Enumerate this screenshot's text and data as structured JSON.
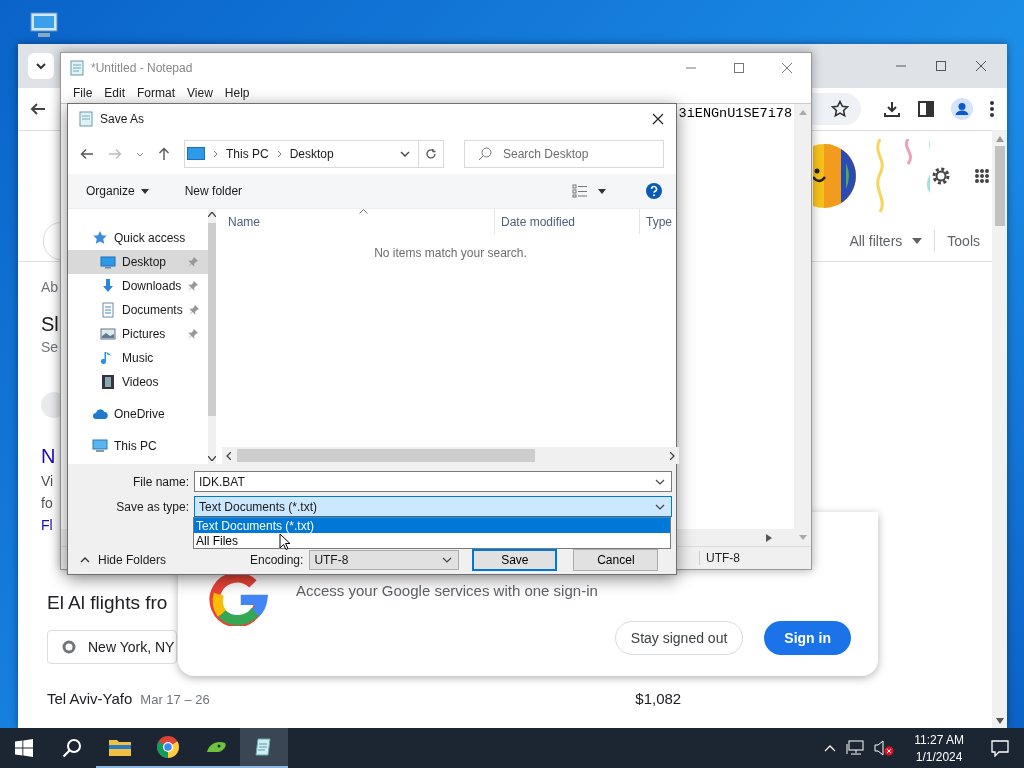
{
  "chrome": {
    "filters": [
      {
        "label": "All filters",
        "kind": "menu"
      },
      {
        "label": "Tools",
        "kind": "plain"
      }
    ],
    "page_fragments": [
      {
        "text": "Ab",
        "kind": "label"
      },
      {
        "text": "Sl",
        "kind": "title"
      },
      {
        "text": "Se",
        "kind": "label"
      },
      {
        "text": "N",
        "kind": "heading"
      },
      {
        "text": "Vi",
        "kind": "body"
      },
      {
        "text": "fo",
        "kind": "body"
      },
      {
        "text": "Fl",
        "kind": "link"
      }
    ],
    "flights_heading": "El Al flights fro",
    "origin_field": "New York, NY",
    "result": {
      "destination": "Tel Aviv-Yafo",
      "dates": "Mar 17 – 26",
      "price": "$1,082"
    }
  },
  "signin_popup": {
    "message": "Access your Google services with one sign-in",
    "buttons": [
      {
        "label": "Stay signed out",
        "kind": "outline"
      },
      {
        "label": "Sign in",
        "kind": "primary"
      }
    ]
  },
  "notepad": {
    "title": "*Untitled - Notepad",
    "menu": [
      "File",
      "Edit",
      "Format",
      "View",
      "Help"
    ],
    "text": [
      "3iENGnU1SE7i78"
    ],
    "encoding": "UTF-8"
  },
  "save_dialog": {
    "title": "Save As",
    "breadcrumb": [
      "This PC",
      "Desktop"
    ],
    "search_placeholder": "Search Desktop",
    "toolbar": [
      {
        "label": "Organize",
        "kind": "menu"
      },
      {
        "label": "New folder",
        "kind": "plain"
      }
    ],
    "nav": [
      {
        "label": "Quick access",
        "kind": "star",
        "selected": false,
        "pinned": false,
        "children": [
          {
            "label": "Desktop",
            "kind": "desktop",
            "selected": true,
            "pinned": true
          },
          {
            "label": "Downloads",
            "kind": "download",
            "selected": false,
            "pinned": true
          },
          {
            "label": "Documents",
            "kind": "documents",
            "selected": false,
            "pinned": true
          },
          {
            "label": "Pictures",
            "kind": "pictures",
            "selected": false,
            "pinned": true
          },
          {
            "label": "Music",
            "kind": "music",
            "selected": false,
            "pinned": false
          },
          {
            "label": "Videos",
            "kind": "videos",
            "selected": false,
            "pinned": false
          }
        ]
      },
      {
        "label": "OneDrive",
        "kind": "cloud",
        "selected": false,
        "pinned": false
      },
      {
        "label": "This PC",
        "kind": "pc",
        "selected": false,
        "pinned": false
      }
    ],
    "columns": [
      "Name",
      "Date modified",
      "Type"
    ],
    "empty_message": "No items match your search.",
    "file_name_label": "File name:",
    "file_name": "IDK.BAT",
    "type_label": "Save as type:",
    "save_as_type": "Text Documents (*.txt)",
    "type_options": [
      {
        "label": "Text Documents (*.txt)",
        "selected": true
      },
      {
        "label": "All Files",
        "selected": false
      }
    ],
    "hide_folders": "Hide Folders",
    "encoding_label": "Encoding:",
    "encoding": "UTF-8",
    "buttons": [
      "Save",
      "Cancel"
    ]
  },
  "taskbar": {
    "time": "11:27 AM",
    "date": "1/1/2024"
  }
}
